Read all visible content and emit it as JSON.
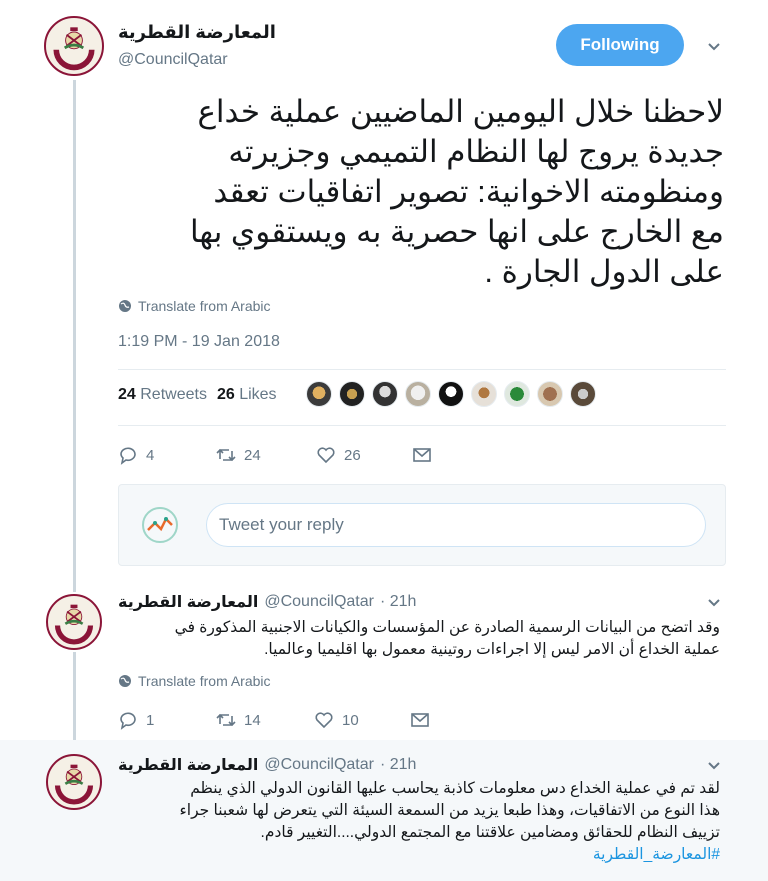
{
  "account": {
    "name": "المعارضة القطرية",
    "handle": "@CouncilQatar",
    "follow_label": "Following"
  },
  "main_tweet": {
    "text_lines": [
      "لاحظنا خلال اليومين الماضيين عملية خداع",
      "جديدة يروج لها   النظام التميمي وجزيرته",
      "ومنظومته الاخوانية: تصوير اتفاقيات تعقد",
      "مع الخارج على انها حصرية به  ويستقوي بها",
      "على الدول الجارة ."
    ],
    "translate_label": "Translate from Arabic",
    "timestamp": "1:19 PM - 19 Jan 2018",
    "retweets_count": "24",
    "retweets_label": "Retweets",
    "likes_count": "26",
    "likes_label": "Likes",
    "actions": {
      "replies": "4",
      "retweets": "24",
      "likes": "26"
    }
  },
  "reply_box": {
    "placeholder": "Tweet your reply"
  },
  "replies": [
    {
      "name": "المعارضة القطرية",
      "handle": "@CouncilQatar",
      "time": "· 21h",
      "text_lines": [
        "وقد اتضح من البيانات الرسمية الصادرة عن المؤسسات والكيانات الاجنبية المذكورة في",
        "عملية الخداع  أن الامر ليس إلا اجراءات روتينية معمول بها اقليميا وعالميا."
      ],
      "translate_label": "Translate from Arabic",
      "actions": {
        "replies": "1",
        "retweets": "14",
        "likes": "10"
      }
    },
    {
      "name": "المعارضة القطرية",
      "handle": "@CouncilQatar",
      "time": "· 21h",
      "text_lines": [
        "لقد تم في عملية الخداع دس معلومات كاذبة  يحاسب عليها القانون الدولي الذي ينظم",
        "هذا النوع من الاتفاقيات، وهذا طبعا  يزيد  من السمعة السيئة التي يتعرض لها شعبنا جراء",
        "تزييف النظام للحقائق ومضامين علاقتنا مع المجتمع الدولي....التغيير قادم."
      ],
      "hashtag": "#المعارضة_القطرية"
    }
  ],
  "colors": {
    "accent": "#1da1f2",
    "follow_button": "#4ca6f0",
    "secondary_text": "#657786",
    "thread_line": "#ccd6dd",
    "highlight_bg": "#f5f8fa"
  },
  "icons": [
    "qatar-emblem-avatar",
    "globe-icon",
    "reply-icon",
    "retweet-icon",
    "like-icon",
    "message-icon",
    "chevron-down-icon"
  ]
}
